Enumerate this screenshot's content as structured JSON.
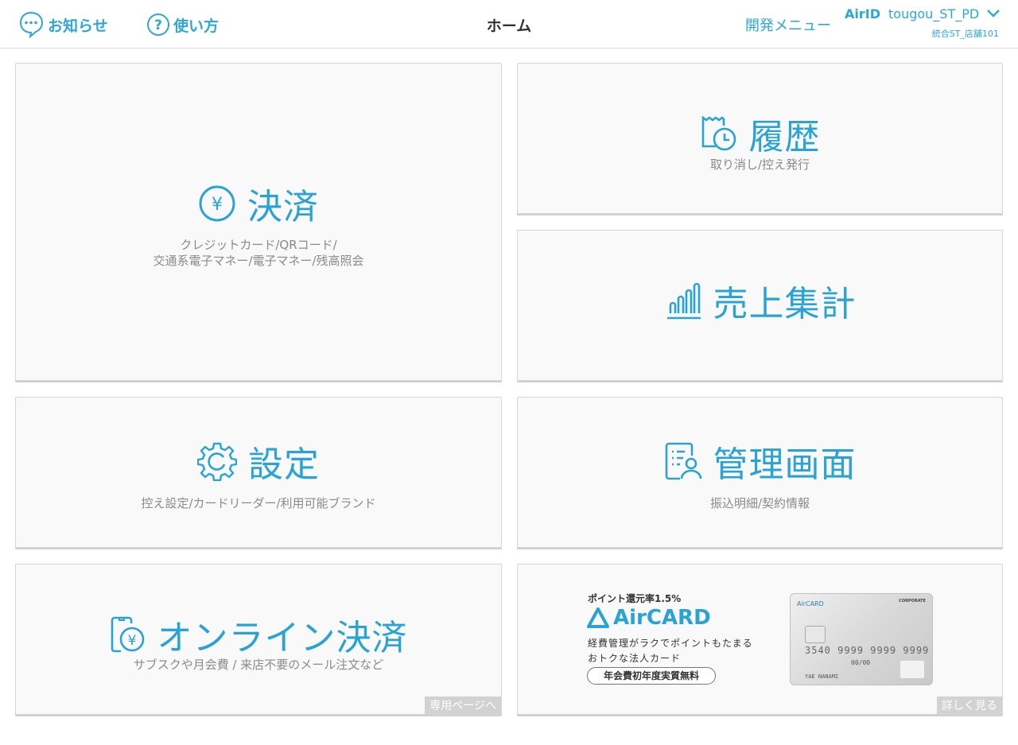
{
  "header": {
    "notice_label": "お知らせ",
    "howto_label": "使い方",
    "title": "ホーム",
    "dev_menu_label": "開発メニュー",
    "airid_logo": "AirID",
    "user_name": "tougou_ST_PD",
    "store_name": "統合ST_店舗101"
  },
  "tiles": {
    "payment": {
      "label": "決済",
      "sub1": "クレジットカード/QRコード/",
      "sub2": "交通系電子マネー/電子マネー/残高照会"
    },
    "history": {
      "label": "履歴",
      "sub": "取り消し/控え発行"
    },
    "sales": {
      "label": "売上集計"
    },
    "settings": {
      "label": "設定",
      "sub": "控え設定/カードリーダー/利用可能ブランド"
    },
    "admin": {
      "label": "管理画面",
      "sub": "振込明細/契約情報"
    },
    "online": {
      "label": "オンライン決済",
      "sub": "サブスクや月会費 / 来店不要のメール注文など",
      "corner": "専用ページへ"
    },
    "ad": {
      "point": "ポイント還元率1.5%",
      "logo": "AirCARD",
      "desc1": "経費管理がラクでポイントもたまる",
      "desc2": "おトクな法人カード",
      "pill": "年会費初年度実質無料",
      "corner": "詳しく見る",
      "card_logo": "AirCARD",
      "card_corp": "CORPORATE",
      "card_number": "3540 9999 9999 9999",
      "card_expiry": "00/00",
      "card_name": "YAE NANAMI"
    }
  },
  "colors": {
    "accent": "#29a3d6",
    "sub_text": "#8a8a8a",
    "tile_bg": "#f9f9f9"
  }
}
